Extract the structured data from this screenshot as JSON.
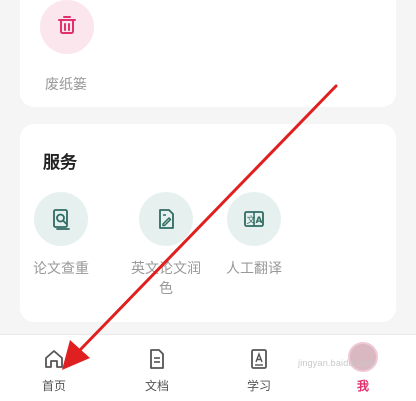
{
  "top_card": {
    "trash_label": "废纸篓"
  },
  "services": {
    "title": "服务",
    "items": [
      {
        "label": "论文查重",
        "icon": "report-check-icon"
      },
      {
        "label": "英文论文润色",
        "icon": "edit-paper-icon"
      },
      {
        "label": "人工翻译",
        "icon": "translate-icon"
      }
    ]
  },
  "bottom_nav": {
    "items": [
      {
        "label": "首页",
        "icon": "home-icon"
      },
      {
        "label": "文档",
        "icon": "document-icon"
      },
      {
        "label": "学习",
        "icon": "book-icon"
      },
      {
        "label": "我",
        "icon": "avatar"
      }
    ]
  },
  "watermark": "jingyan.baidu.com",
  "colors": {
    "accent_pink": "#e0306e",
    "service_icon_green": "#2f6b63",
    "arrow_red": "#e02020"
  }
}
